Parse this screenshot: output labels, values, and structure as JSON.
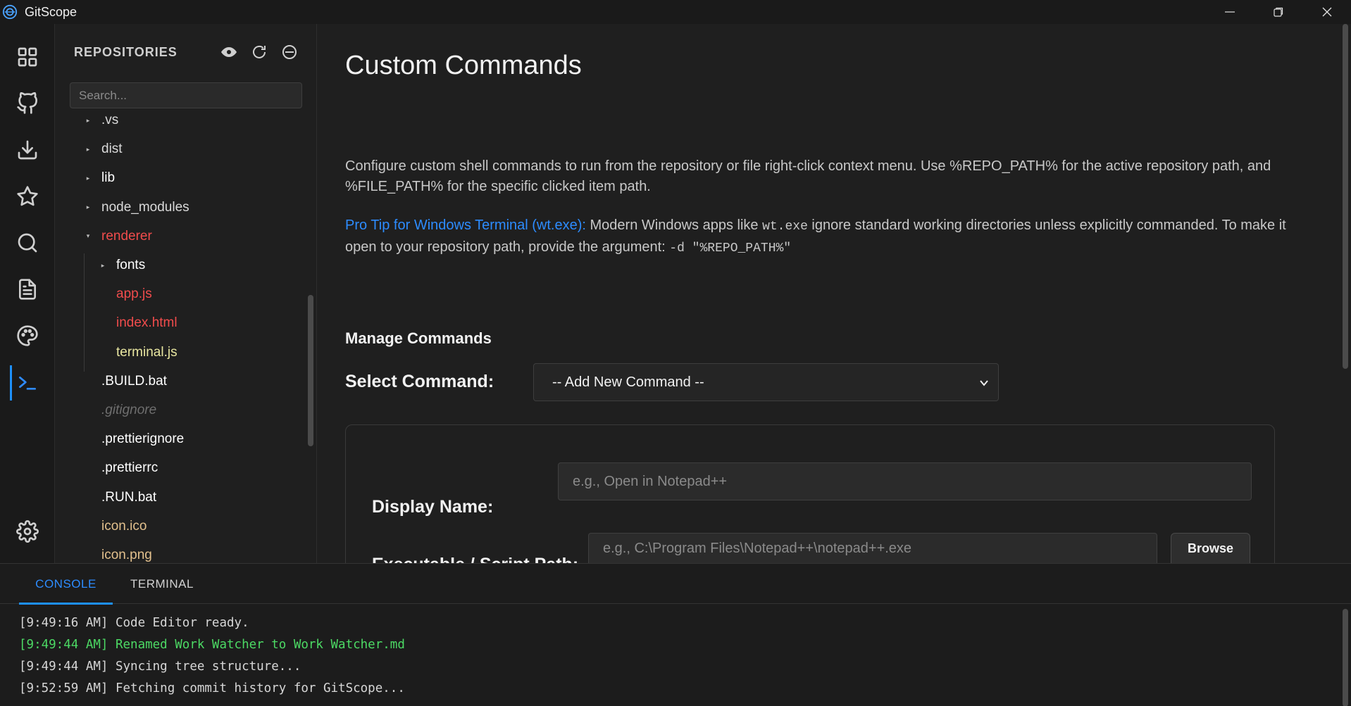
{
  "window": {
    "title": "GitScope"
  },
  "activity_bar": {
    "items": [
      {
        "name": "dashboard",
        "icon": "grid-icon"
      },
      {
        "name": "github",
        "icon": "github-icon"
      },
      {
        "name": "download",
        "icon": "download-icon"
      },
      {
        "name": "favorites",
        "icon": "star-icon"
      },
      {
        "name": "search",
        "icon": "search-icon"
      },
      {
        "name": "document",
        "icon": "file-text-icon"
      },
      {
        "name": "themes",
        "icon": "palette-icon"
      },
      {
        "name": "terminal",
        "icon": "terminal-icon",
        "active": true
      },
      {
        "name": "settings",
        "icon": "gear-icon"
      }
    ]
  },
  "sidebar": {
    "title": "REPOSITORIES",
    "search_placeholder": "Search...",
    "tree": [
      {
        "label": ".vs",
        "type": "folder",
        "expanded": false,
        "color": "#d9d9d9",
        "depth": 0
      },
      {
        "label": "dist",
        "type": "folder",
        "expanded": false,
        "color": "#d9d9d9",
        "depth": 0
      },
      {
        "label": "lib",
        "type": "folder",
        "expanded": false,
        "color": "#ffffff",
        "depth": 0
      },
      {
        "label": "node_modules",
        "type": "folder",
        "expanded": false,
        "color": "#d9d9d9",
        "depth": 0
      },
      {
        "label": "renderer",
        "type": "folder",
        "expanded": true,
        "color": "#f14c4c",
        "depth": 0
      },
      {
        "label": "fonts",
        "type": "folder",
        "expanded": false,
        "color": "#ffffff",
        "depth": 1
      },
      {
        "label": "app.js",
        "type": "file",
        "color": "#f14c4c",
        "depth": 1
      },
      {
        "label": "index.html",
        "type": "file",
        "color": "#f14c4c",
        "depth": 1
      },
      {
        "label": "terminal.js",
        "type": "file",
        "color": "#e8e6a0",
        "depth": 1
      },
      {
        "label": ".BUILD.bat",
        "type": "file",
        "color": "#ffffff",
        "depth": 0
      },
      {
        "label": ".gitignore",
        "type": "file",
        "color": "#6e6e6e",
        "italic": true,
        "depth": 0
      },
      {
        "label": ".prettierignore",
        "type": "file",
        "color": "#ffffff",
        "depth": 0
      },
      {
        "label": ".prettierrc",
        "type": "file",
        "color": "#ffffff",
        "depth": 0
      },
      {
        "label": ".RUN.bat",
        "type": "file",
        "color": "#ffffff",
        "depth": 0
      },
      {
        "label": "icon.ico",
        "type": "file",
        "color": "#e2c08d",
        "depth": 0
      },
      {
        "label": "icon.png",
        "type": "file",
        "color": "#e2c08d",
        "depth": 0
      }
    ]
  },
  "main": {
    "title": "Custom Commands",
    "description": "Configure custom shell commands to run from the repository or file right-click context menu. Use %REPO_PATH% for the active repository path, and %FILE_PATH% for the specific clicked item path.",
    "tip": {
      "label": "Pro Tip for Windows Terminal (wt.exe):",
      "text_1": " Modern Windows apps like ",
      "code_1": "wt.exe",
      "text_2": " ignore standard working directories unless explicitly commanded. To make it open to your repository path, provide the argument: ",
      "code_2": "-d \"%REPO_PATH%\""
    },
    "manage_title": "Manage Commands",
    "select_label": "Select Command:",
    "select_value": "-- Add New Command --",
    "form": {
      "display_name_label": "Display Name:",
      "display_name_placeholder": "e.g., Open in Notepad++",
      "path_label": "Executable / Script Path:",
      "path_placeholder": "e.g., C:\\Program Files\\Notepad++\\notepad++.exe",
      "browse_label": "Browse"
    }
  },
  "panel": {
    "tabs": [
      {
        "label": "CONSOLE",
        "active": true
      },
      {
        "label": "TERMINAL",
        "active": false
      }
    ],
    "logs": [
      {
        "text": "[9:49:16 AM] Code Editor ready.",
        "level": "info"
      },
      {
        "text": "[9:49:44 AM] Renamed Work Watcher to Work Watcher.md",
        "level": "success"
      },
      {
        "text": "[9:49:44 AM] Syncing tree structure...",
        "level": "info"
      },
      {
        "text": "[9:52:59 AM] Fetching commit history for GitScope...",
        "level": "info"
      }
    ]
  },
  "colors": {
    "accent": "#1e90ff",
    "tip": "#2d8cff",
    "success": "#4cd964",
    "modified": "#f14c4c"
  }
}
